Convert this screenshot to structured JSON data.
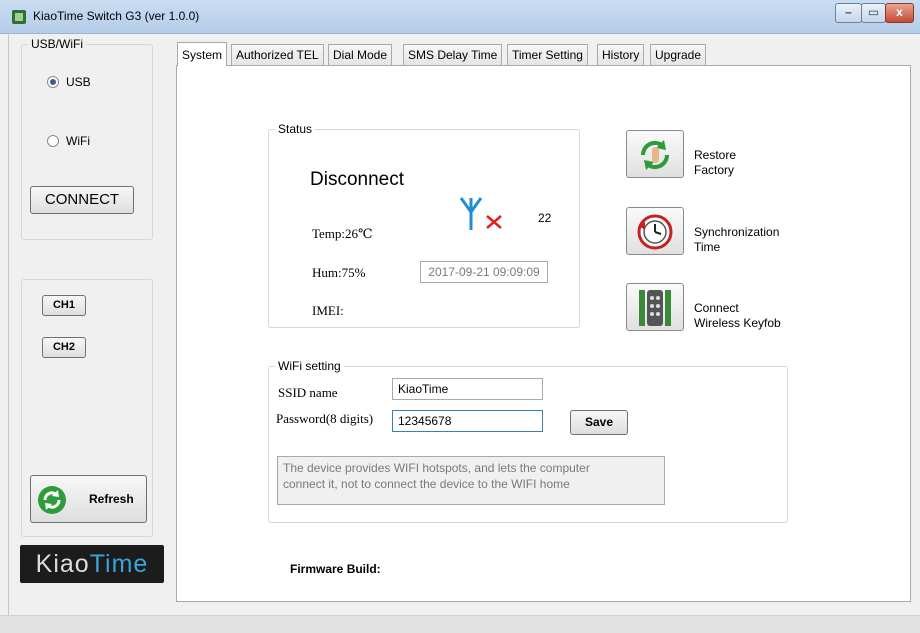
{
  "window": {
    "title": "KiaoTime Switch G3 (ver 1.0.0)",
    "controls": {
      "minimize": "–",
      "maximize": "▭",
      "close": "x"
    }
  },
  "sidebar": {
    "group_title": "USB/WiFi",
    "radio_usb": "USB",
    "radio_wifi": "WiFi",
    "selected": "USB",
    "connect_label": "CONNECT",
    "ch1_label": "CH1",
    "ch2_label": "CH2",
    "refresh_label": "Refresh",
    "logo_text_a": "Kiao",
    "logo_text_b": "Time"
  },
  "tabs": [
    "System",
    "Authorized TEL",
    "Dial Mode",
    "SMS Delay Time",
    "Timer Setting",
    "History",
    "Upgrade"
  ],
  "active_tab": "System",
  "status": {
    "group_title": "Status",
    "connection": "Disconnect",
    "signal_value": "22",
    "temp": "Temp:26℃",
    "hum": "Hum:75%",
    "datetime": "2017-09-21 09:09:09",
    "imei": "IMEI:"
  },
  "actions": {
    "restore_line1": "Restore",
    "restore_line2": "Factory",
    "sync_line1": "Synchronization",
    "sync_line2": "Time",
    "keyfob_line1": "Connect",
    "keyfob_line2": "Wireless Keyfob"
  },
  "wifi": {
    "group_title": "WiFi setting",
    "ssid_label": "SSID name",
    "ssid_value": "KiaoTime",
    "password_label": "Password(8 digits)",
    "password_value": "12345678",
    "save_label": "Save",
    "note_line1": "The device provides WIFI hotspots, and lets the computer",
    "note_line2": "connect it, not to connect the device to the WIFI home"
  },
  "firmware_label": "Firmware Build:",
  "colors": {
    "accent": "#3a5e8c",
    "signal": "#1e8fd6",
    "error": "#e02020"
  }
}
